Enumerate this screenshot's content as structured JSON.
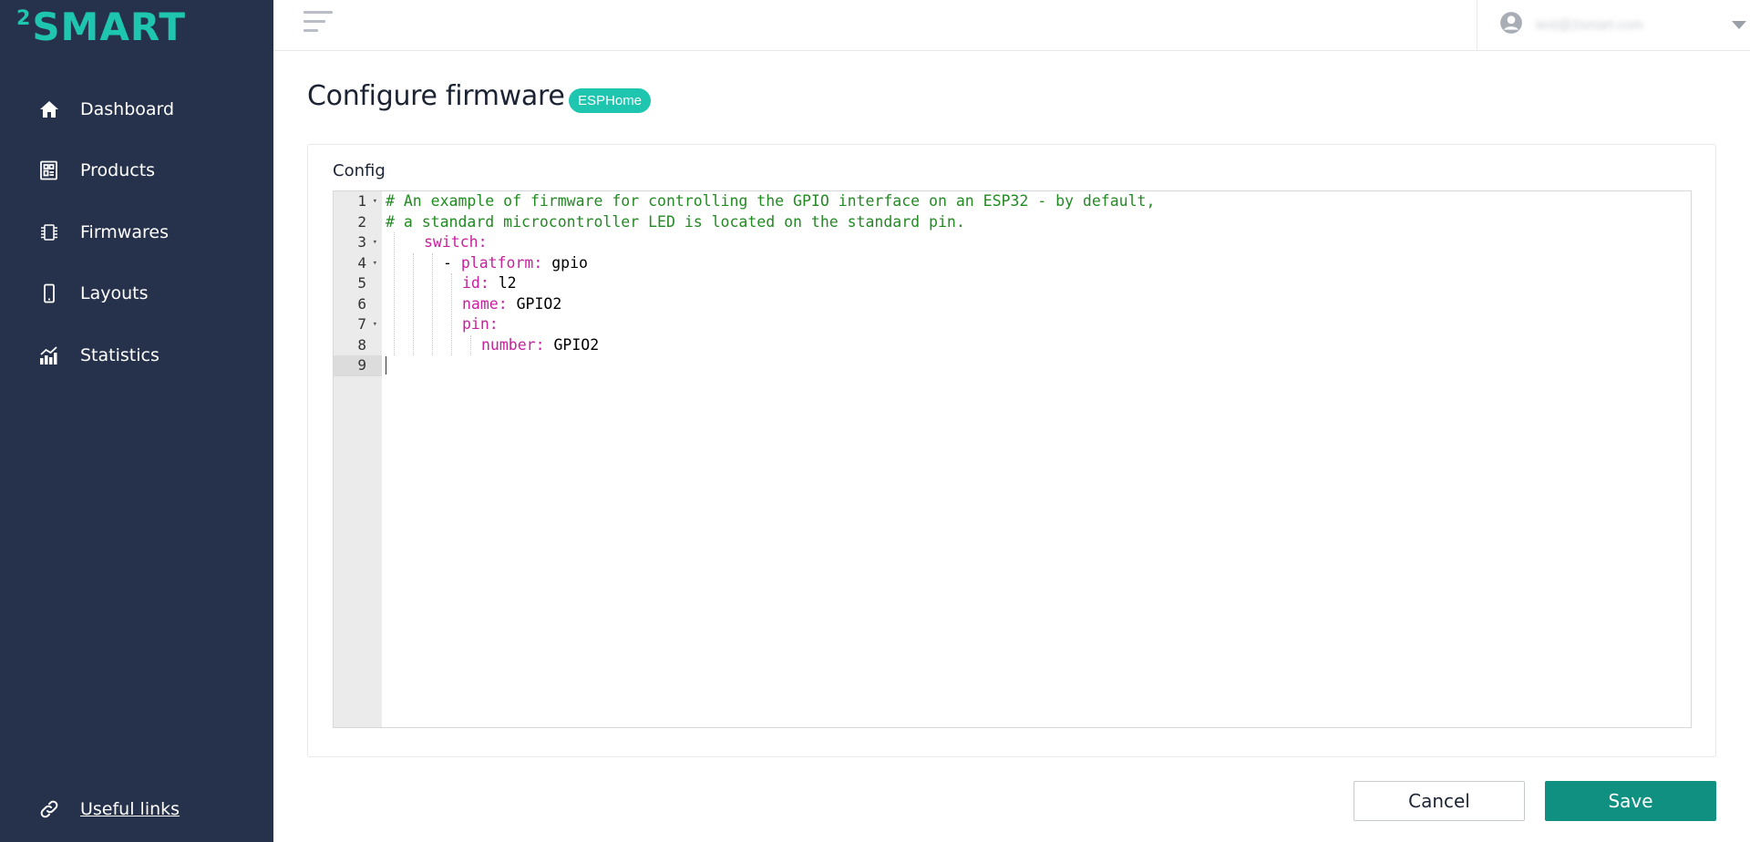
{
  "brand": {
    "sup": "2",
    "word": "SMART",
    "color": "#1ec6b0"
  },
  "sidebar": {
    "items": [
      {
        "label": "Dashboard",
        "icon": "home-icon"
      },
      {
        "label": "Products",
        "icon": "products-icon"
      },
      {
        "label": "Firmwares",
        "icon": "chip-icon"
      },
      {
        "label": "Layouts",
        "icon": "smartphone-icon"
      },
      {
        "label": "Statistics",
        "icon": "chart-icon"
      }
    ],
    "footer_link": {
      "label": "Useful links",
      "icon": "link-icon"
    }
  },
  "header": {
    "user_email": "test@2smart.com",
    "icons": [
      "hamburger-icon",
      "user-avatar-icon",
      "chevron-down-icon"
    ]
  },
  "page": {
    "title": "Configure firmware",
    "badge": "ESPHome"
  },
  "config": {
    "label": "Config",
    "lines": [
      {
        "n": "1",
        "fold": true,
        "key": "",
        "val": "",
        "comment": "# An example of firmware for controlling the GPIO interface on an ESP32 - by default,"
      },
      {
        "n": "2",
        "fold": false,
        "key": "",
        "val": "",
        "comment": "# a standard microcontroller LED is located on the standard pin."
      },
      {
        "n": "3",
        "fold": true,
        "key": "switch:",
        "val": "",
        "comment": ""
      },
      {
        "n": "4",
        "fold": true,
        "key": "platform:",
        "val": " gpio",
        "comment": ""
      },
      {
        "n": "5",
        "fold": false,
        "key": "id:",
        "val": " l2",
        "comment": ""
      },
      {
        "n": "6",
        "fold": false,
        "key": "name:",
        "val": " GPIO2",
        "comment": ""
      },
      {
        "n": "7",
        "fold": true,
        "key": "pin:",
        "val": "",
        "comment": ""
      },
      {
        "n": "8",
        "fold": false,
        "key": "number:",
        "val": " GPIO2",
        "comment": ""
      },
      {
        "n": "9",
        "fold": false,
        "key": "",
        "val": "",
        "comment": ""
      }
    ],
    "list_dash": "- ",
    "colors": {
      "comment": "#238a23",
      "key": "#c8219e",
      "value": "#000000"
    }
  },
  "actions": {
    "cancel_label": "Cancel",
    "save_label": "Save",
    "save_color": "#109080"
  }
}
